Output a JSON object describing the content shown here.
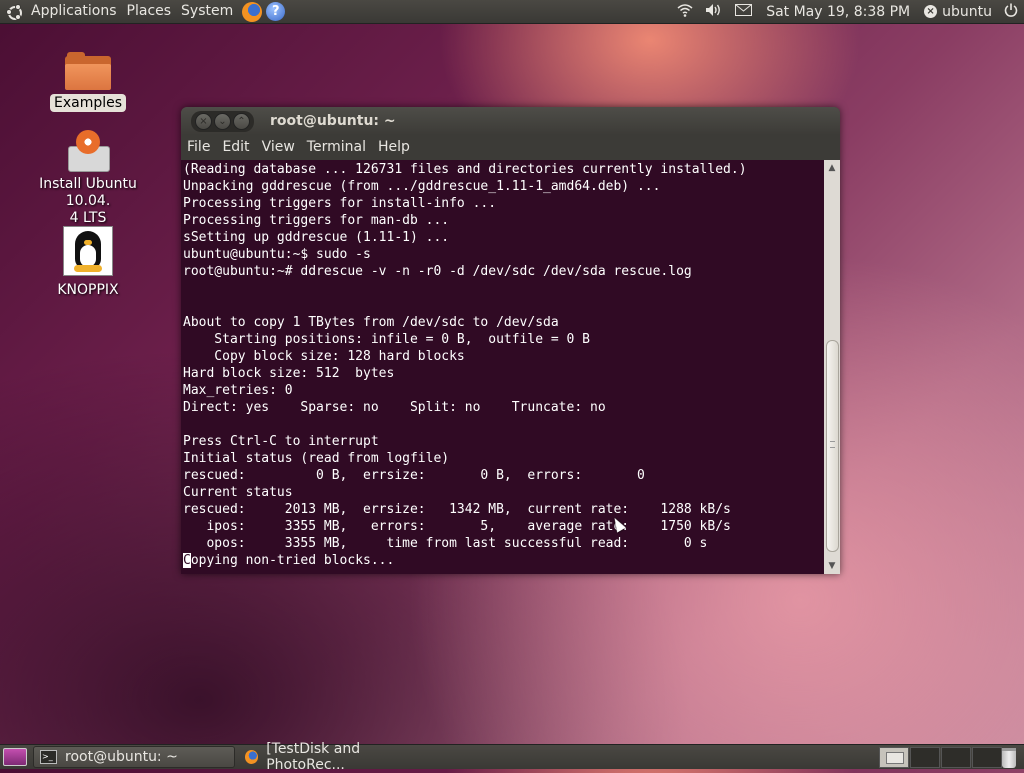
{
  "top_panel": {
    "menu": [
      "Applications",
      "Places",
      "System"
    ],
    "clock": "Sat May 19,  8:38 PM",
    "user": "ubuntu",
    "icons": [
      "ubuntu-logo-icon",
      "firefox-icon",
      "help-icon",
      "wifi-icon",
      "volume-icon",
      "mail-icon",
      "user-status-icon",
      "power-icon"
    ]
  },
  "desktop_icons": [
    {
      "label": "Examples",
      "icon": "folder-icon"
    },
    {
      "label": "Install Ubuntu 10.04.\n4 LTS",
      "icon": "install-icon"
    },
    {
      "label": "KNOPPIX",
      "icon": "tux-icon"
    }
  ],
  "terminal_window": {
    "title": "root@ubuntu: ~",
    "menu": [
      "File",
      "Edit",
      "View",
      "Terminal",
      "Help"
    ],
    "lines_before_cursor": "(Reading database ... 126731 files and directories currently installed.)\nUnpacking gddrescue (from .../gddrescue_1.11-1_amd64.deb) ...\nProcessing triggers for install-info ...\nProcessing triggers for man-db ...\nsSetting up gddrescue (1.11-1) ...\nubuntu@ubuntu:~$ sudo -s\nroot@ubuntu:~# ddrescue -v -n -r0 -d /dev/sdc /dev/sda rescue.log\n\n\nAbout to copy 1 TBytes from /dev/sdc to /dev/sda\n    Starting positions: infile = 0 B,  outfile = 0 B\n    Copy block size: 128 hard blocks\nHard block size: 512  bytes\nMax_retries: 0\nDirect: yes    Sparse: no    Split: no    Truncate: no\n\nPress Ctrl-C to interrupt\nInitial status (read from logfile)\nrescued:         0 B,  errsize:       0 B,  errors:       0\nCurrent status\nrescued:     2013 MB,  errsize:   1342 MB,  current rate:    1288 kB/s\n   ipos:     3355 MB,   errors:       5,    average rate:    1750 kB/s\n   opos:     3355 MB,     time from last successful read:       0 s\n",
    "cursor_char": "C",
    "last_line_rest": "opying non-tried blocks..."
  },
  "bottom_panel": {
    "tasks": [
      {
        "label": "root@ubuntu: ~",
        "icon": "terminal-icon",
        "active": true
      },
      {
        "label": "[TestDisk and PhotoRec...",
        "icon": "firefox-icon",
        "active": false
      }
    ]
  },
  "colors": {
    "terminal_bg": "#300a24",
    "panel_bg": "#3c3b37",
    "text": "#ffffff"
  }
}
